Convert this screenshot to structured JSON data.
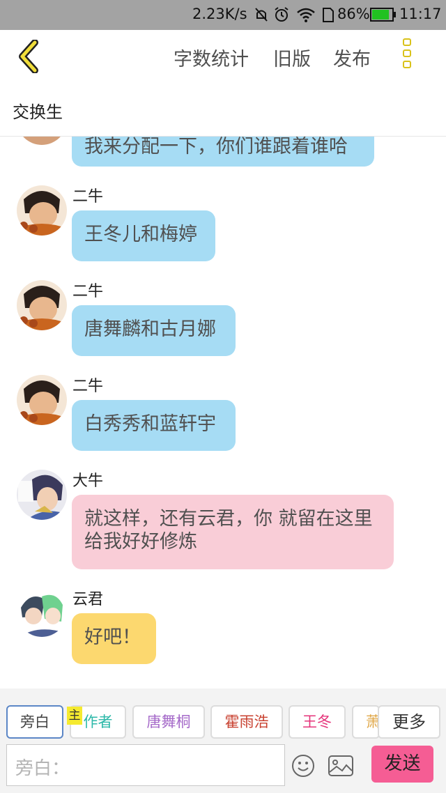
{
  "status_bar": {
    "speed": "2.23K/s",
    "battery_pct": "86%",
    "time": "11:17",
    "battery_level": 0.86,
    "battery_color": "#21c121"
  },
  "toolbar": {
    "word_count": "字数统计",
    "old_version": "旧版",
    "publish": "发布"
  },
  "title": "交换生",
  "colors": {
    "accent": "#d9c21a",
    "bubble_blue": "#a6dcf4",
    "bubble_pink": "#f9cdd7",
    "bubble_yellow": "#fcd86f",
    "send_button": "#f55d94"
  },
  "messages": [
    {
      "sender": "",
      "text": "我来分配一下，你们谁跟着谁哈"
    },
    {
      "sender": "二牛",
      "text": "王冬儿和梅婷"
    },
    {
      "sender": "二牛",
      "text": "唐舞麟和古月娜"
    },
    {
      "sender": "二牛",
      "text": "白秀秀和蓝轩宇"
    },
    {
      "sender": "大牛",
      "text": "就这样，还有云君，你 就留在这里给我好好修炼"
    },
    {
      "sender": "云君",
      "text": "好吧！"
    }
  ],
  "role_bar": {
    "narrator": "旁白",
    "host_tag": "主",
    "author": "作者",
    "roles": [
      "唐舞桐",
      "霍雨浩",
      "王冬",
      "萧"
    ],
    "more": "更多"
  },
  "composer": {
    "placeholder": "旁白：",
    "send": "发送"
  }
}
